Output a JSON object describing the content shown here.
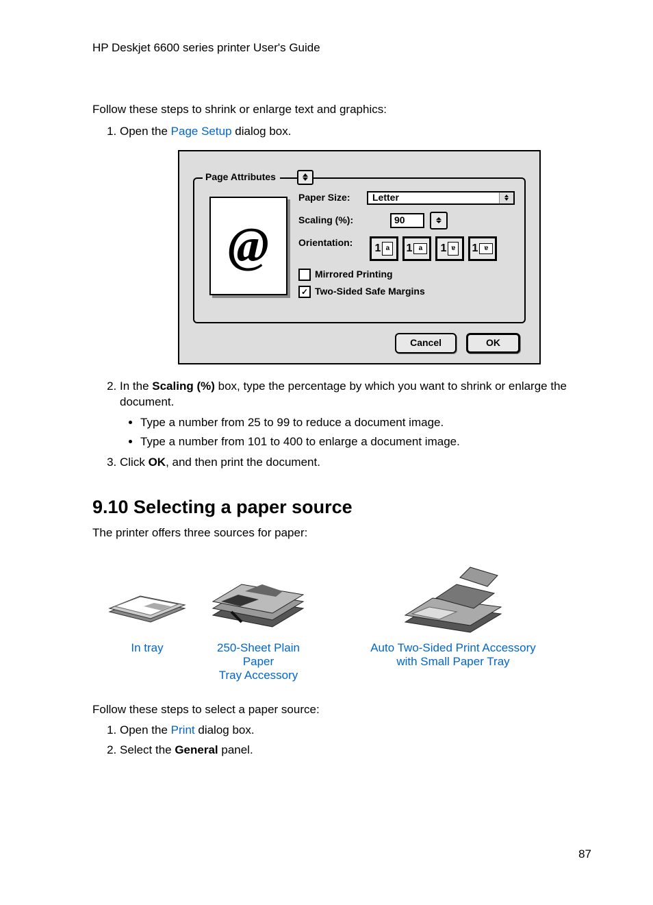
{
  "header": "HP Deskjet 6600 series printer User's Guide",
  "intro1": "Follow these steps to shrink or enlarge text and graphics:",
  "step1_a": "Open the ",
  "step1_link": "Page Setup",
  "step1_b": " dialog box.",
  "dialog": {
    "tab_title": "Page Attributes",
    "paper_size_label": "Paper Size:",
    "paper_size_value": "Letter",
    "scaling_label": "Scaling (%):",
    "scaling_value": "90",
    "orientation_label": "Orientation:",
    "mirrored_label": "Mirrored Printing",
    "twosided_label": "Two-Sided Safe Margins",
    "cancel": "Cancel",
    "ok": "OK",
    "preview_symbol": "@"
  },
  "step2_a": "In the ",
  "step2_bold": "Scaling (%)",
  "step2_b": " box, type the percentage by which you want to shrink or enlarge the document.",
  "bullet1": "Type a number from 25 to 99 to reduce a document image.",
  "bullet2": "Type a number from 101 to 400 to enlarge a document image.",
  "step3_a": "Click ",
  "step3_bold": "OK",
  "step3_b": ", and then print the document.",
  "section_heading": "9.10  Selecting a paper source",
  "section_intro": "The printer offers three sources for paper:",
  "cap1": "In tray",
  "cap2a": "250-Sheet Plain Paper",
  "cap2b": "Tray Accessory",
  "cap3a": "Auto Two-Sided Print Accessory",
  "cap3b": "with Small Paper Tray",
  "intro2": "Follow these steps to select a paper source:",
  "s2_step1_a": "Open the ",
  "s2_step1_link": "Print",
  "s2_step1_b": " dialog box.",
  "s2_step2_a": "Select the ",
  "s2_step2_bold": "General",
  "s2_step2_b": " panel.",
  "page_number": "87"
}
